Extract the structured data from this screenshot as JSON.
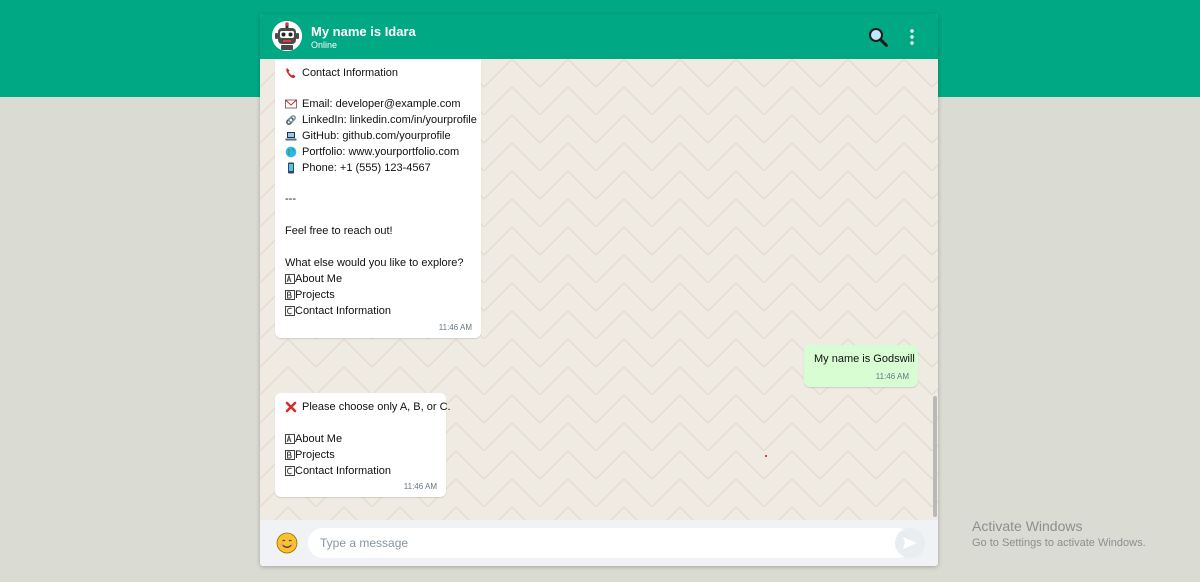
{
  "colors": {
    "brand": "#00a884",
    "chat_bg": "#efeae2",
    "outgoing_bubble": "#d9fdd3",
    "page_bg": "#dadbd3"
  },
  "header": {
    "title": "My name is Idara",
    "status": "Online",
    "avatar_icon": "robot-avatar-icon",
    "search_icon": "search-icon",
    "menu_icon": "kebab-menu-icon"
  },
  "messages": [
    {
      "direction": "incoming",
      "lines": [
        {
          "icon": "telephone-icon",
          "text": "Contact Information"
        },
        {
          "icon": "email-icon",
          "text": "Email: developer@example.com"
        },
        {
          "icon": "link-icon",
          "text": "LinkedIn: linkedin.com/in/yourprofile"
        },
        {
          "icon": "laptop-icon",
          "text": "GitHub: github.com/yourprofile"
        },
        {
          "icon": "globe-icon",
          "text": "Portfolio: www.yourportfolio.com"
        },
        {
          "icon": "mobile-phone-icon",
          "text": "Phone: +1 (555) 123-4567"
        },
        {
          "icon": "",
          "text": "---"
        },
        {
          "icon": "",
          "text": "Feel free to reach out!"
        },
        {
          "icon": "",
          "text": "What else would you like to explore?"
        },
        {
          "icon": "option-a-icon",
          "text": "About Me"
        },
        {
          "icon": "option-b-icon",
          "text": "Projects"
        },
        {
          "icon": "option-c-icon",
          "text": "Contact Information"
        }
      ],
      "time": "11:46 AM"
    },
    {
      "direction": "outgoing",
      "text": "My name is Godswill",
      "time": "11:46 AM"
    },
    {
      "direction": "incoming",
      "lines": [
        {
          "icon": "cross-mark-icon",
          "text": "Please choose only A, B, or C."
        },
        {
          "icon": "option-a-icon",
          "text": "About Me"
        },
        {
          "icon": "option-b-icon",
          "text": "Projects"
        },
        {
          "icon": "option-c-icon",
          "text": "Contact Information"
        }
      ],
      "time": "11:46 AM"
    }
  ],
  "composer": {
    "placeholder": "Type a message",
    "emoji_icon": "smiley-face-icon",
    "send_icon": "send-arrow-icon"
  },
  "watermark": {
    "line1": "Activate Windows",
    "line2": "Go to Settings to activate Windows."
  }
}
